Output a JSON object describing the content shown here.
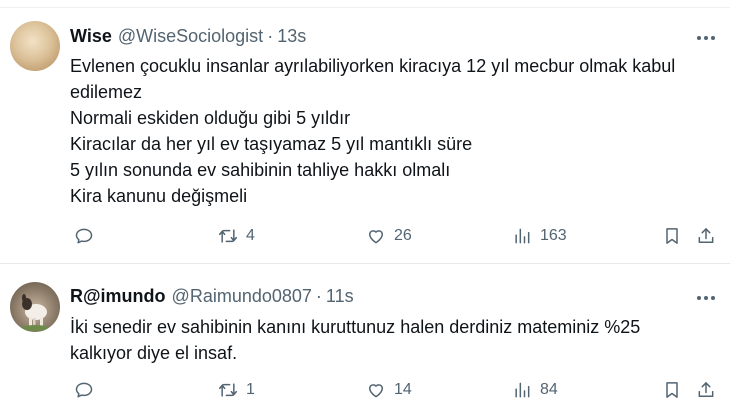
{
  "tweets": [
    {
      "name": "Wise",
      "handle": "@WiseSociologist",
      "separator": "·",
      "time": "13s",
      "lines": [
        "Evlenen çocuklu insanlar ayrılabiliyorken kiracıya 12 yıl mecbur olmak kabul",
        "edilemez",
        "Normali eskiden olduğu gibi 5 yıldır",
        "Kiracılar da her yıl ev taşıyamaz 5 yıl mantıklı süre",
        "5 yılın sonunda ev sahibinin tahliye hakkı olmalı",
        "Kira kanunu değişmeli"
      ],
      "stats": {
        "replies": "",
        "retweets": "4",
        "likes": "26",
        "views": "163"
      }
    },
    {
      "name": "R@imundo",
      "handle": "@Raimundo0807",
      "separator": "·",
      "time": "11s",
      "lines": [
        "İki senedir ev sahibinin kanını kuruttunuz halen derdiniz mateminiz %25",
        "kalkıyor diye el insaf."
      ],
      "stats": {
        "replies": "",
        "retweets": "1",
        "likes": "14",
        "views": "84"
      }
    }
  ],
  "icons": {
    "reply": "reply-icon",
    "retweet": "retweet-icon",
    "like": "heart-icon",
    "views": "views-icon",
    "bookmark": "bookmark-icon",
    "share": "share-icon",
    "more": "more-icon"
  },
  "colors": {
    "text": "#0f1419",
    "secondary": "#536471",
    "divider": "#e6e9ec"
  }
}
